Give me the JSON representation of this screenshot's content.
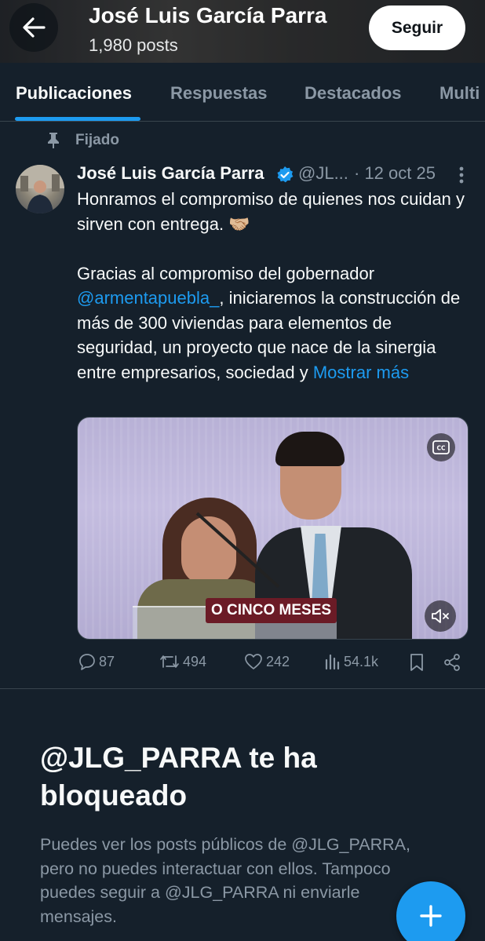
{
  "header": {
    "name": "José Luis García Parra",
    "posts": "1,980 posts",
    "follow_label": "Seguir"
  },
  "tabs": [
    {
      "label": "Publicaciones",
      "active": true
    },
    {
      "label": "Respuestas",
      "active": false
    },
    {
      "label": "Destacados",
      "active": false
    },
    {
      "label": "Multi",
      "active": false
    }
  ],
  "pinned": {
    "label": "Fijado"
  },
  "tweet": {
    "author": "José Luis García Parra",
    "handle": "@JL...",
    "date": "· 12 oct 25",
    "text_line1": "Honramos el compromiso de quienes nos cuidan y sirven con entrega. 🤝🏼",
    "text_p2_before": "Gracias al compromiso del gobernador ",
    "mention": "@armentapuebla_",
    "text_p2_after": ", iniciaremos la construcción de más de 300 viviendas para elementos de seguridad, un proyecto que nace de la sinergia entre empresarios, sociedad y ",
    "show_more": "Mostrar más",
    "media_subtitle": "O CINCO MESES",
    "stats": {
      "replies": "87",
      "reposts": "494",
      "likes": "242",
      "views": "54.1k"
    }
  },
  "blocked": {
    "title": "@JLG_PARRA te ha bloqueado",
    "description": "Puedes ver los posts públicos de @JLG_PARRA, pero no puedes interactuar con ellos. Tampoco puedes seguir a @JLG_PARRA ni enviarle mensajes."
  },
  "colors": {
    "background": "#15202b",
    "accent": "#1d9bf0",
    "muted": "#8b98a5"
  }
}
